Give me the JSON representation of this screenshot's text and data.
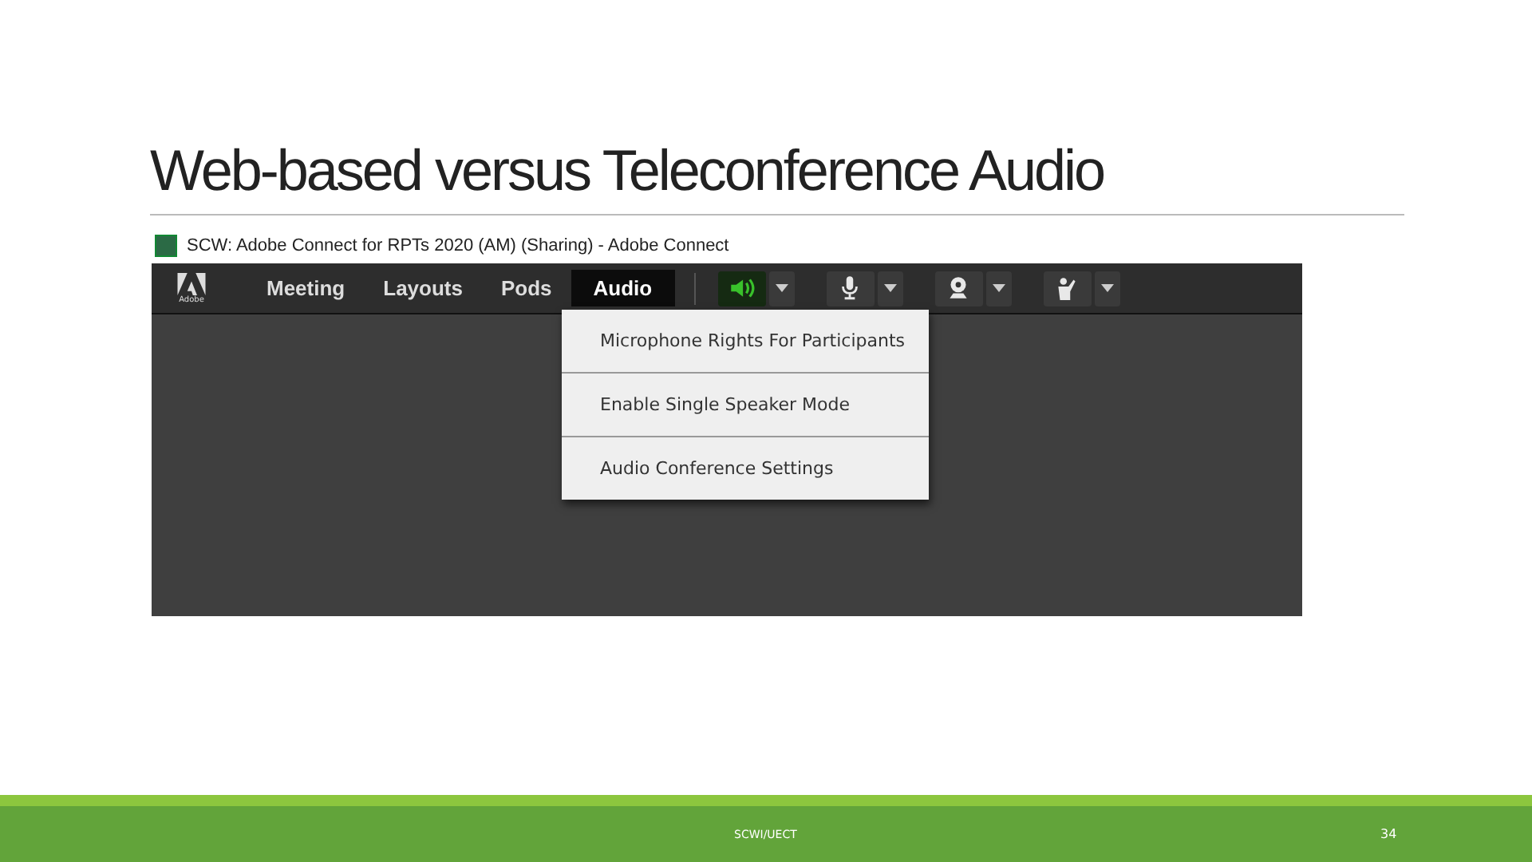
{
  "slide": {
    "title": "Web-based versus Teleconference Audio",
    "footer": "SCWI/UECT",
    "page_number": "34"
  },
  "app": {
    "window_title": "SCW: Adobe Connect for RPTs 2020 (AM) (Sharing) - Adobe Connect",
    "logo_text": "Adobe",
    "menus": [
      {
        "label": "Meeting",
        "selected": false
      },
      {
        "label": "Layouts",
        "selected": false
      },
      {
        "label": "Pods",
        "selected": false
      },
      {
        "label": "Audio",
        "selected": true
      }
    ],
    "toolbar_buttons": [
      {
        "kind": "speaker",
        "on": true
      },
      {
        "kind": "microphone",
        "on": false
      },
      {
        "kind": "camera",
        "on": false
      },
      {
        "kind": "hand",
        "on": false
      }
    ],
    "dropdown": {
      "items": [
        "Microphone Rights For Participants",
        "Enable Single Speaker Mode",
        "Audio Conference Settings"
      ]
    }
  }
}
